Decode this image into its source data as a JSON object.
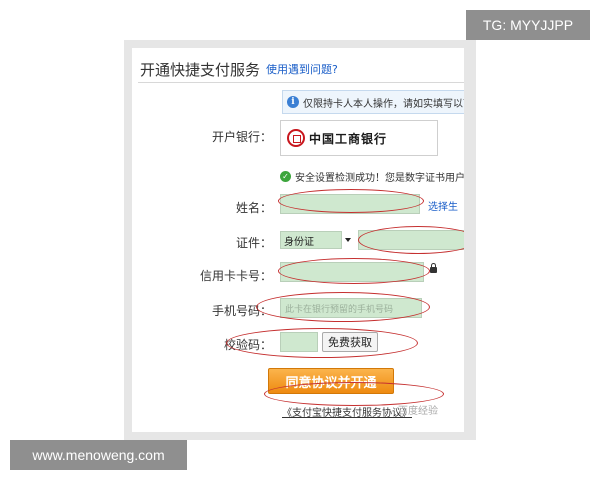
{
  "watermarks": {
    "top_right": "TG: MYYJJPP",
    "bottom_left": "www.menoweng.com"
  },
  "header": {
    "title": "开通快捷支付服务",
    "help_link": "使用遇到问题?"
  },
  "notice": {
    "icon": "info-icon",
    "text": "仅限持卡人本人操作，请如实填写以下"
  },
  "form": {
    "bank_label": "开户银行：",
    "bank_name": "中国工商银行",
    "verify_icon": "check-icon",
    "verify_text": "安全设置检测成功！您是数字证书用户,",
    "name_label": "姓名：",
    "name_value": "",
    "choose_link": "选择生",
    "id_label": "证件：",
    "id_type_selected": "身份证",
    "id_value": "",
    "card_label": "信用卡卡号：",
    "card_value": "",
    "phone_label": "手机号码：",
    "phone_placeholder": "此卡在银行预留的手机号码",
    "code_label": "校验码：",
    "code_value": "",
    "get_code_button": "免费获取",
    "submit_button": "同意协议并开通",
    "agree_text": "《支付宝快捷支付服务协议》",
    "baidu_watermark": "百度经验"
  },
  "colors": {
    "field_bg": "#cfe8cf",
    "annotation": "#c53030",
    "submit": "#ee8a10",
    "link": "#1a5ec8"
  }
}
